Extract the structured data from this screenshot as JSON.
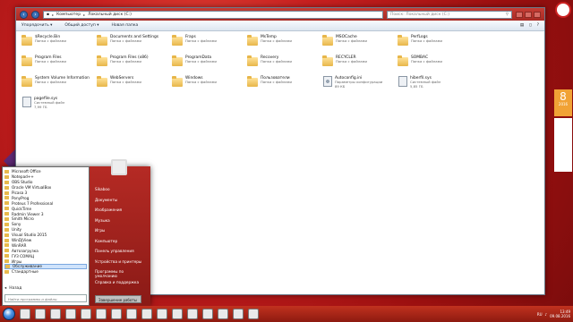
{
  "explorer": {
    "address_crumbs": [
      "Компьютер",
      "Локальный диск (C:)"
    ],
    "search_placeholder": "Поиск: Локальный диск (C:)",
    "toolbar": {
      "organize": "Упорядочить ▾",
      "share": "Общий доступ ▾",
      "new_folder": "Новая папка"
    },
    "items": [
      {
        "name": "$Recycle.Bin",
        "sub": "Папка с файлами",
        "icon": "folder-icon"
      },
      {
        "name": "Documents and Settings",
        "sub": "Папка с файлами",
        "icon": "folder-icon"
      },
      {
        "name": "Fraps",
        "sub": "Папка с файлами",
        "icon": "folder-icon"
      },
      {
        "name": "MsTemp",
        "sub": "Папка с файлами",
        "icon": "folder-icon"
      },
      {
        "name": "MSOCache",
        "sub": "Папка с файлами",
        "icon": "folder-icon"
      },
      {
        "name": "PerfLogs",
        "sub": "Папка с файлами",
        "icon": "folder-icon"
      },
      {
        "name": "Program Files",
        "sub": "Папка с файлами",
        "icon": "folder-icon"
      },
      {
        "name": "Program Files (x86)",
        "sub": "Папка с файлами",
        "icon": "folder-icon"
      },
      {
        "name": "ProgramData",
        "sub": "Папка с файлами",
        "icon": "folder-icon"
      },
      {
        "name": "Recovery",
        "sub": "Папка с файлами",
        "icon": "folder-icon"
      },
      {
        "name": "RECYCLER",
        "sub": "Папка с файлами",
        "icon": "folder-icon"
      },
      {
        "name": "SOMBAC",
        "sub": "Папка с файлами",
        "icon": "folder-icon"
      },
      {
        "name": "System Volume Information",
        "sub": "Папка с файлами",
        "icon": "folder-icon"
      },
      {
        "name": "WebServers",
        "sub": "Папка с файлами",
        "icon": "folder-icon"
      },
      {
        "name": "Windows",
        "sub": "Папка с файлами",
        "icon": "folder-icon"
      },
      {
        "name": "Пользователи",
        "sub": "Папка с файлами",
        "icon": "folder-icon"
      },
      {
        "name": "Autoconfig.ini",
        "sub": "Параметры конфигурации",
        "size": "89 КБ",
        "icon": "gear-file-icon"
      },
      {
        "name": "hiberfil.sys",
        "sub": "Системный файл",
        "size": "5,85 ГБ",
        "icon": "file-icon"
      },
      {
        "name": "pagefile.sys",
        "sub": "Системный файл",
        "size": "7,99 ГБ",
        "icon": "file-icon"
      }
    ]
  },
  "start_menu": {
    "programs": [
      "Microsoft Office",
      "Notepad++",
      "OBS Studio",
      "Oracle VM VirtualBox",
      "Picasa 3",
      "PonyProg",
      "Proteus 7 Professional",
      "QuickTime",
      "Radmin Viewer 3",
      "Smith Micro",
      "Sony",
      "Unity",
      "Visual Studio 2015",
      "WinDjView",
      "WinRAR",
      "Автозагрузка",
      "ГУЗ СОМАЦ",
      "Игры",
      "Обслуживание",
      "Стандартные"
    ],
    "highlighted_index": 18,
    "back_label": "Назад",
    "search_placeholder": "Найти программы и файлы",
    "right_links": [
      "Sikaboo",
      "Документы",
      "Изображения",
      "Музыка",
      "Игры",
      "Компьютер",
      "Панель управления",
      "Устройства и принтеры",
      "Программы по умолчанию",
      "Справка и поддержка"
    ],
    "shutdown_label": "Завершение работы"
  },
  "taskbar": {
    "tray_lang": "RU",
    "clock_time": "13:49",
    "clock_date": "09.08.2016"
  },
  "gadgets": {
    "calendar_day": "8",
    "calendar_year": "2016"
  }
}
